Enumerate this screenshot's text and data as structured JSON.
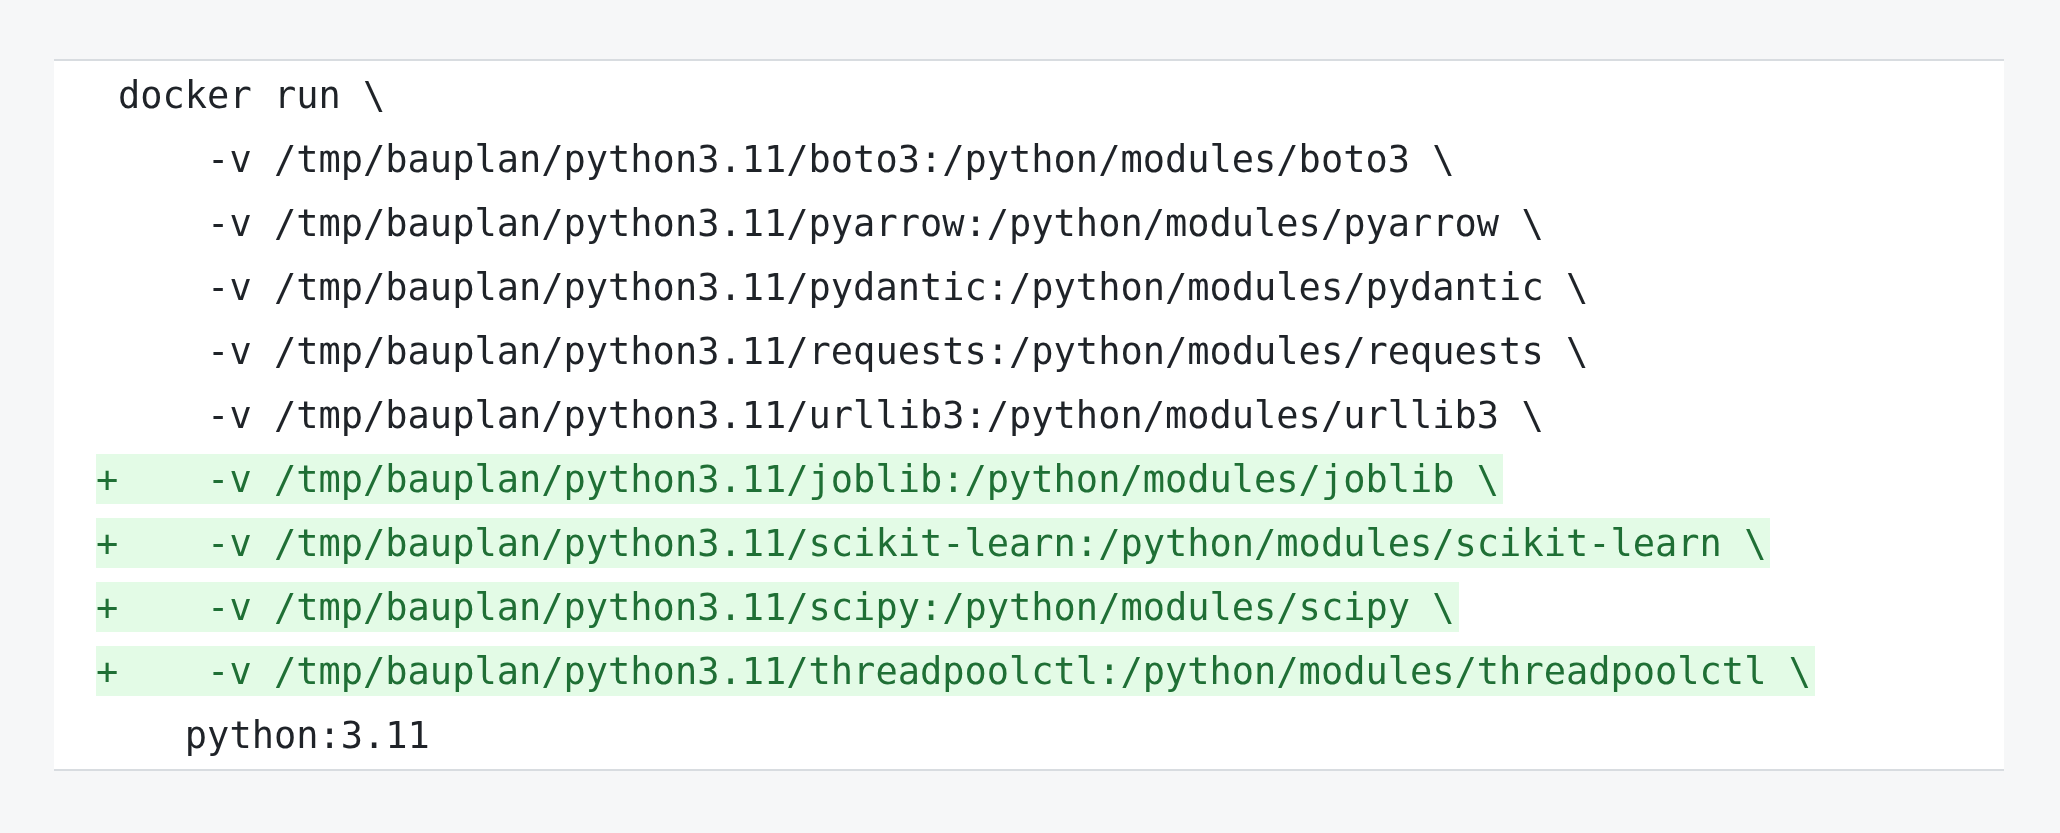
{
  "diff_lines": [
    {
      "added": false,
      "text": "docker run \\"
    },
    {
      "added": false,
      "text": "    -v /tmp/bauplan/python3.11/boto3:/python/modules/boto3 \\"
    },
    {
      "added": false,
      "text": "    -v /tmp/bauplan/python3.11/pyarrow:/python/modules/pyarrow \\"
    },
    {
      "added": false,
      "text": "    -v /tmp/bauplan/python3.11/pydantic:/python/modules/pydantic \\"
    },
    {
      "added": false,
      "text": "    -v /tmp/bauplan/python3.11/requests:/python/modules/requests \\"
    },
    {
      "added": false,
      "text": "    -v /tmp/bauplan/python3.11/urllib3:/python/modules/urllib3 \\"
    },
    {
      "added": true,
      "prefix": "+",
      "text": "    -v /tmp/bauplan/python3.11/joblib:/python/modules/joblib \\"
    },
    {
      "added": true,
      "prefix": "+",
      "text": "    -v /tmp/bauplan/python3.11/scikit-learn:/python/modules/scikit-learn \\"
    },
    {
      "added": true,
      "prefix": "+",
      "text": "    -v /tmp/bauplan/python3.11/scipy:/python/modules/scipy \\"
    },
    {
      "added": true,
      "prefix": "+",
      "text": "    -v /tmp/bauplan/python3.11/threadpoolctl:/python/modules/threadpoolctl \\"
    },
    {
      "added": false,
      "text": "   python:3.11"
    }
  ]
}
